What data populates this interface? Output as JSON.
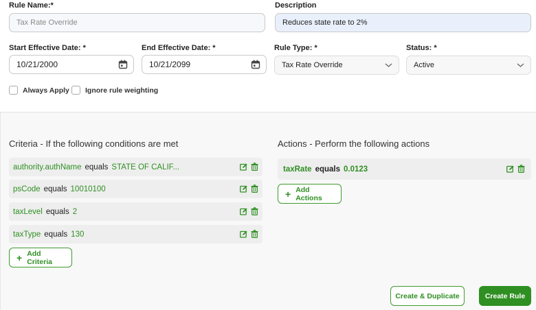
{
  "form": {
    "rule_name_label": "Rule Name:*",
    "rule_name_placeholder": "Tax Rate Override",
    "description_label": "Description",
    "description_value": "Reduces state rate to 2%",
    "start_date_label": "Start Effective Date: *",
    "start_date_value": "10/21/2000",
    "end_date_label": "End Effective Date: *",
    "end_date_value": "10/21/2099",
    "rule_type_label": "Rule Type: *",
    "rule_type_value": "Tax Rate Override",
    "status_label": "Status: *",
    "status_value": "Active",
    "always_apply_label": "Always Apply",
    "ignore_weighting_label": "Ignore rule weighting"
  },
  "criteria": {
    "title": "Criteria - If the following conditions are met",
    "rows": [
      {
        "field": "authority.authName",
        "op": "equals",
        "value": "STATE OF CALIF..."
      },
      {
        "field": "psCode",
        "op": "equals",
        "value": "10010100"
      },
      {
        "field": "taxLevel",
        "op": "equals",
        "value": "2"
      },
      {
        "field": "taxType",
        "op": "equals",
        "value": "130"
      }
    ],
    "add_label": "Add Criteria"
  },
  "actions": {
    "title": "Actions - Perform the following actions",
    "rows": [
      {
        "field": "taxRate",
        "op": "equals",
        "value": "0.0123"
      }
    ],
    "add_label": "Add Actions"
  },
  "footer": {
    "create_duplicate_label": "Create & Duplicate",
    "create_rule_label": "Create Rule"
  },
  "colors": {
    "accent": "#2f8f22"
  },
  "icons": [
    "calendar-icon",
    "chevron-down-icon",
    "edit-icon",
    "trash-icon",
    "plus-icon"
  ]
}
